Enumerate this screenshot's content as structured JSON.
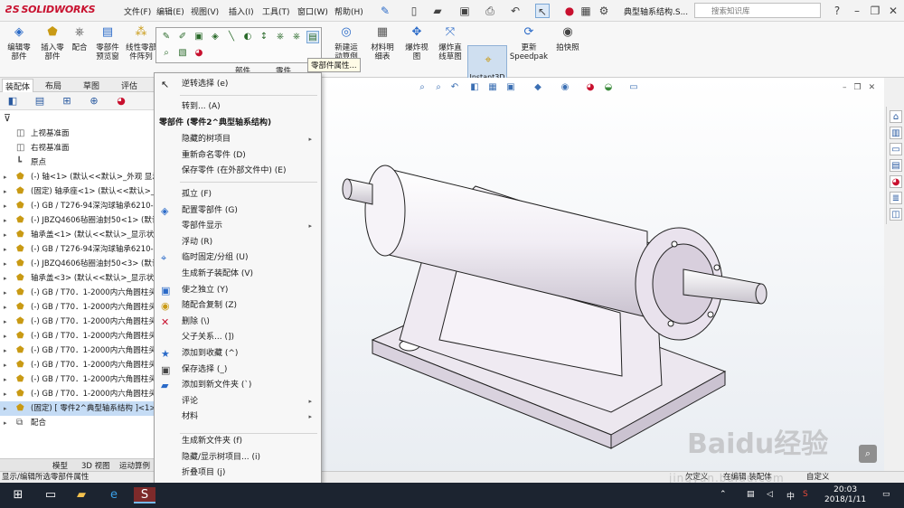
{
  "titlebar": {
    "logo": "SOLIDWORKS",
    "menus": [
      "文件(F)",
      "编辑(E)",
      "视图(V)",
      "插入(I)",
      "工具(T)",
      "窗口(W)",
      "帮助(H)"
    ],
    "doc_title": "典型轴系结构.S...",
    "search_placeholder": "搜索知识库",
    "help_glyph": "?",
    "pin_glyph": "⊥"
  },
  "ribbon": {
    "buttons": [
      {
        "label": "编辑零\n部件"
      },
      {
        "label": "插入零\n部件"
      },
      {
        "label": "配合"
      },
      {
        "label": "零部件\n预览窗"
      },
      {
        "label": "线性零部\n件阵列"
      },
      {
        "label": "新建运\n动算例"
      },
      {
        "label": "材料明\n细表"
      },
      {
        "label": "爆炸视\n图"
      },
      {
        "label": "爆炸直\n线草图"
      },
      {
        "label": "Instant3D"
      },
      {
        "label": "更新\nSpeedpak"
      },
      {
        "label": "拍快照"
      }
    ],
    "group_labels": [
      "部件",
      "零件"
    ]
  },
  "cm_tabs": [
    "装配体",
    "布局",
    "草图",
    "评估"
  ],
  "feature_tree": {
    "rows": [
      {
        "text": "上视基准面",
        "arrow": "",
        "icon": "plane"
      },
      {
        "text": "右视基准面",
        "arrow": "",
        "icon": "plane"
      },
      {
        "text": "原点",
        "arrow": "",
        "icon": "origin"
      },
      {
        "text": "(-) 轴<1> (默认<<默认>_外观 显示",
        "arrow": "▸",
        "icon": "part"
      },
      {
        "text": "(固定) 轴承座<1> (默认<<默认>_外",
        "arrow": "▸",
        "icon": "part"
      },
      {
        "text": "(-) GB / T276-94深沟球轴承6210-",
        "arrow": "▸",
        "icon": "part"
      },
      {
        "text": "(-) JBZQ4606毡圈油封50<1> (默认",
        "arrow": "▸",
        "icon": "part"
      },
      {
        "text": "轴承盖<1> (默认<<默认>_显示状",
        "arrow": "▸",
        "icon": "part"
      },
      {
        "text": "(-) GB / T276-94深沟球轴承6210-",
        "arrow": "▸",
        "icon": "part"
      },
      {
        "text": "(-) JBZQ4606毡圈油封50<3> (默认",
        "arrow": "▸",
        "icon": "part"
      },
      {
        "text": "轴承盖<3> (默认<<默认>_显示状",
        "arrow": "▸",
        "icon": "part"
      },
      {
        "text": "(-) GB / T70．1-2000内六角圆柱头",
        "arrow": "▸",
        "icon": "part"
      },
      {
        "text": "(-) GB / T70．1-2000内六角圆柱头",
        "arrow": "▸",
        "icon": "part"
      },
      {
        "text": "(-) GB / T70．1-2000内六角圆柱头",
        "arrow": "▸",
        "icon": "part"
      },
      {
        "text": "(-) GB / T70．1-2000内六角圆柱头",
        "arrow": "▸",
        "icon": "part"
      },
      {
        "text": "(-) GB / T70．1-2000内六角圆柱头",
        "arrow": "▸",
        "icon": "part"
      },
      {
        "text": "(-) GB / T70．1-2000内六角圆柱头",
        "arrow": "▸",
        "icon": "part"
      },
      {
        "text": "(-) GB / T70．1-2000内六角圆柱头",
        "arrow": "▸",
        "icon": "part"
      },
      {
        "text": "(-) GB / T70．1-2000内六角圆柱头",
        "arrow": "▸",
        "icon": "part"
      },
      {
        "text": "(固定) [ 零件2^典型轴系结构 ]<1>",
        "arrow": "▸",
        "icon": "part",
        "selected": true
      },
      {
        "text": "配合",
        "arrow": "▸",
        "icon": "mate"
      }
    ]
  },
  "bottom_tabs": [
    "模型",
    "3D 视图",
    "运动算例"
  ],
  "status": "显示/编辑所选零部件属性",
  "context_toolbar": {
    "tooltip": "零部件属性..."
  },
  "context_menu": {
    "top_item": "逆转选择 (e)",
    "goto": "转到... (A)",
    "header": "零部件 (零件2^典型轴系结构)",
    "items_a": [
      {
        "label": "隐藏的树项目",
        "sub": true
      },
      {
        "label": "重新命名零件 (D)"
      },
      {
        "label": "保存零件 (在外部文件中) (E)"
      }
    ],
    "items_b": [
      {
        "label": "孤立 (F)"
      },
      {
        "label": "配置零部件 (G)",
        "icon": "config"
      },
      {
        "label": "零部件显示",
        "sub": true
      },
      {
        "label": "浮动 (R)"
      },
      {
        "label": "临时固定/分组 (U)",
        "icon": "fix"
      },
      {
        "label": "生成新子装配体 (V)"
      },
      {
        "label": "使之独立 (Y)",
        "icon": "indep"
      },
      {
        "label": "随配合复制 (Z)",
        "icon": "copy"
      },
      {
        "label": "删除 (\\)",
        "icon": "delete"
      },
      {
        "label": "父子关系... (])"
      },
      {
        "label": "添加到收藏 (^)",
        "icon": "fav"
      },
      {
        "label": "保存选择 (_)",
        "icon": "save"
      },
      {
        "label": "添加到新文件夹 (`)",
        "icon": "folder"
      },
      {
        "label": "评论",
        "sub": true
      },
      {
        "label": "材料",
        "sub": true
      }
    ],
    "items_c": [
      {
        "label": "生成新文件夹 (f)"
      },
      {
        "label": "隐藏/显示树项目... (i)"
      },
      {
        "label": "折叠项目 (j)"
      }
    ],
    "more": "⌄"
  },
  "statusbar_right": [
    "欠定义",
    "在编辑 装配体",
    "自定义"
  ],
  "taskbar": {
    "time": "20:03",
    "date": "2018/1/11",
    "ime": "中"
  },
  "watermark": {
    "main": "Baidu经验",
    "sub": "jingyan.baidu.com"
  },
  "colors": {
    "accent": "#c8102e",
    "selection": "#c5dcf5",
    "taskbar": "#1c2430",
    "part_body": "#f2eef4"
  }
}
